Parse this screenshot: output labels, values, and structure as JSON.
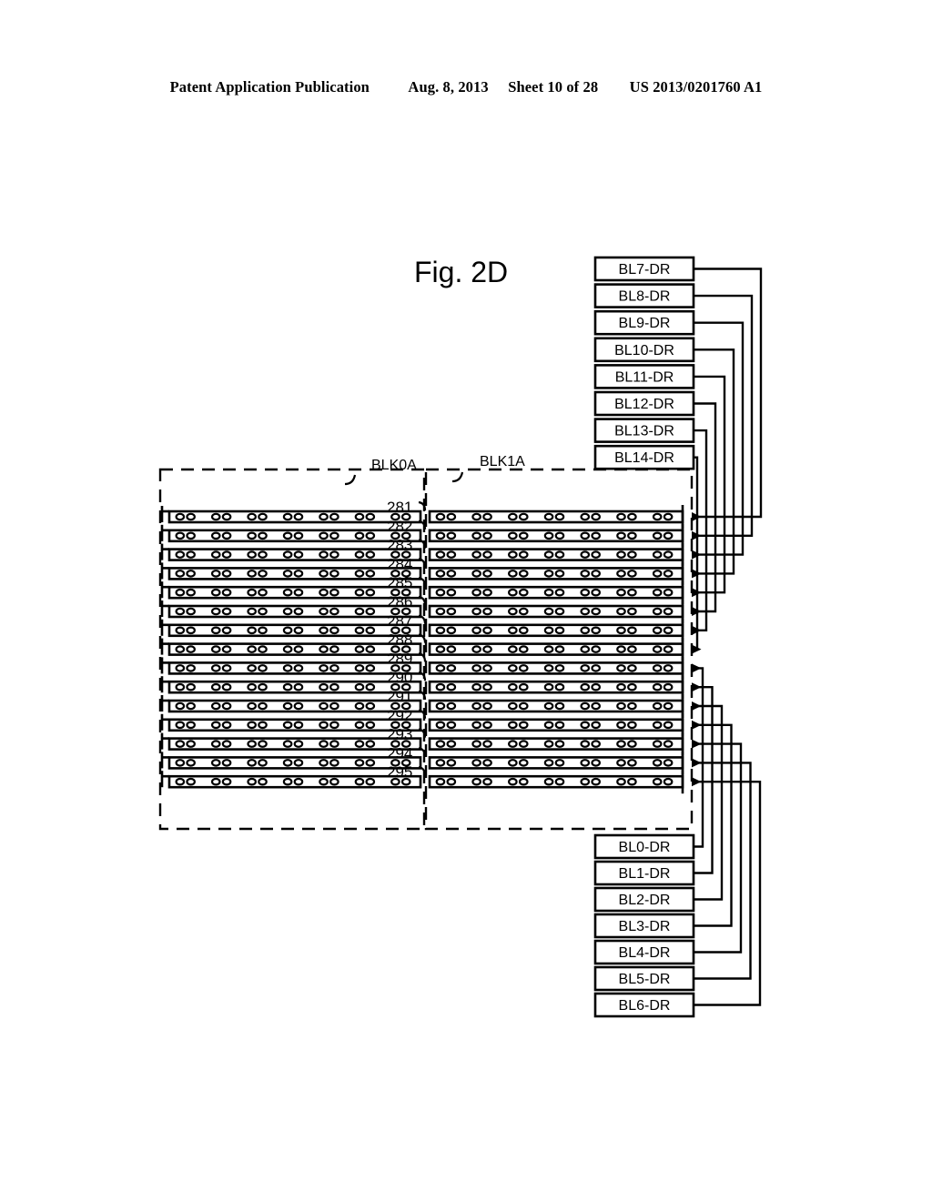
{
  "header": {
    "publication": "Patent Application Publication",
    "date": "Aug. 8, 2013",
    "sheet": "Sheet 10 of 28",
    "docnum": "US 2013/0201760 A1"
  },
  "figure": {
    "title": "Fig. 2D",
    "blocks": [
      {
        "id": "blk0a",
        "label": "BLK0A"
      },
      {
        "id": "blk1a",
        "label": "BLK1A"
      }
    ],
    "bitline_reference_numbers": [
      "281",
      "282",
      "283",
      "284",
      "285",
      "286",
      "287",
      "288",
      "289",
      "290",
      "291",
      "292",
      "293",
      "294",
      "295"
    ],
    "top_drivers": [
      "BL7-DR",
      "BL8-DR",
      "BL9-DR",
      "BL10-DR",
      "BL11-DR",
      "BL12-DR",
      "BL13-DR",
      "BL14-DR"
    ],
    "bottom_drivers": [
      "BL0-DR",
      "BL1-DR",
      "BL2-DR",
      "BL3-DR",
      "BL4-DR",
      "BL5-DR",
      "BL6-DR"
    ],
    "contacts_per_block_per_bitline": 14,
    "contact_pairs_per_block": 7,
    "bitline_count": 15,
    "stroke_color": "#000000",
    "fill_color": "#ffffff"
  }
}
